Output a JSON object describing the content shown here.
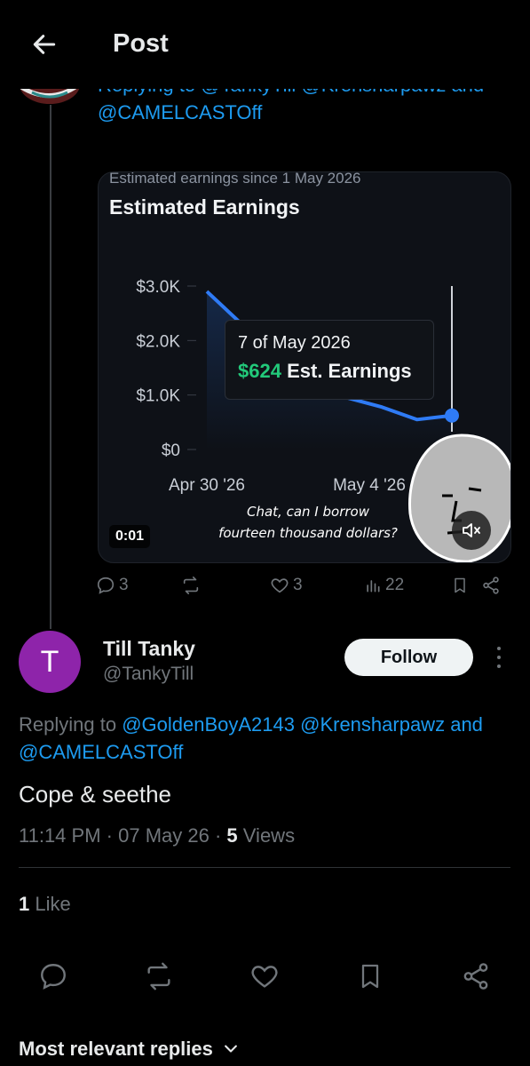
{
  "header": {
    "title": "Post"
  },
  "parent": {
    "replying_text": "Replying to @TankyTill @Krensharpawz and @CAMELCASTOff",
    "media": {
      "subtitle": "Estimated earnings since 1 May 2026",
      "title": "Estimated Earnings",
      "tooltip_date": "7 of May 2026",
      "tooltip_value": "$624",
      "tooltip_label": "Est. Earnings",
      "caption_line1": "Chat, can I borrow",
      "caption_line2": "fourteen thousand dollars?",
      "duration": "0:01"
    },
    "stats": {
      "replies": "3",
      "reposts": "",
      "likes": "3",
      "views": "22"
    }
  },
  "chart_data": {
    "type": "line",
    "title": "Estimated Earnings",
    "subtitle": "Estimated earnings since 1 May 2026",
    "y_ticks": [
      "$3.0K",
      "$2.0K",
      "$1.0K",
      "$0"
    ],
    "x_ticks": [
      "Apr 30 '26",
      "May 4 '26"
    ],
    "ylim": [
      0,
      3000
    ],
    "series": [
      {
        "x": [
          "2026-04-30",
          "2026-05-01",
          "2026-05-02",
          "2026-05-03",
          "2026-05-04",
          "2026-05-05",
          "2026-05-06",
          "2026-05-07"
        ],
        "values": [
          2900,
          2300,
          1700,
          1200,
          950,
          780,
          550,
          624
        ]
      }
    ],
    "color": "#2f7bf5",
    "grid": false
  },
  "reply": {
    "avatar_letter": "T",
    "avatar_color": "#8e24aa",
    "display_name": "Till Tanky",
    "handle": "@TankyTill",
    "follow_label": "Follow",
    "replying_prefix": "Replying to",
    "replying_mentions": "@GoldenBoyA2143 @Krensharpawz",
    "replying_and": "and",
    "replying_last": "@CAMELCASTOff",
    "text": "Cope & seethe",
    "time": "11:14 PM",
    "date": "07 May 26",
    "views_count": "5",
    "views_label": "Views",
    "likes_count": "1",
    "likes_label": "Like"
  },
  "replies_sort": {
    "label": "Most relevant replies"
  },
  "colors": {
    "accent": "#1d9bf0",
    "muted": "#71767b",
    "green": "#22c97a"
  }
}
